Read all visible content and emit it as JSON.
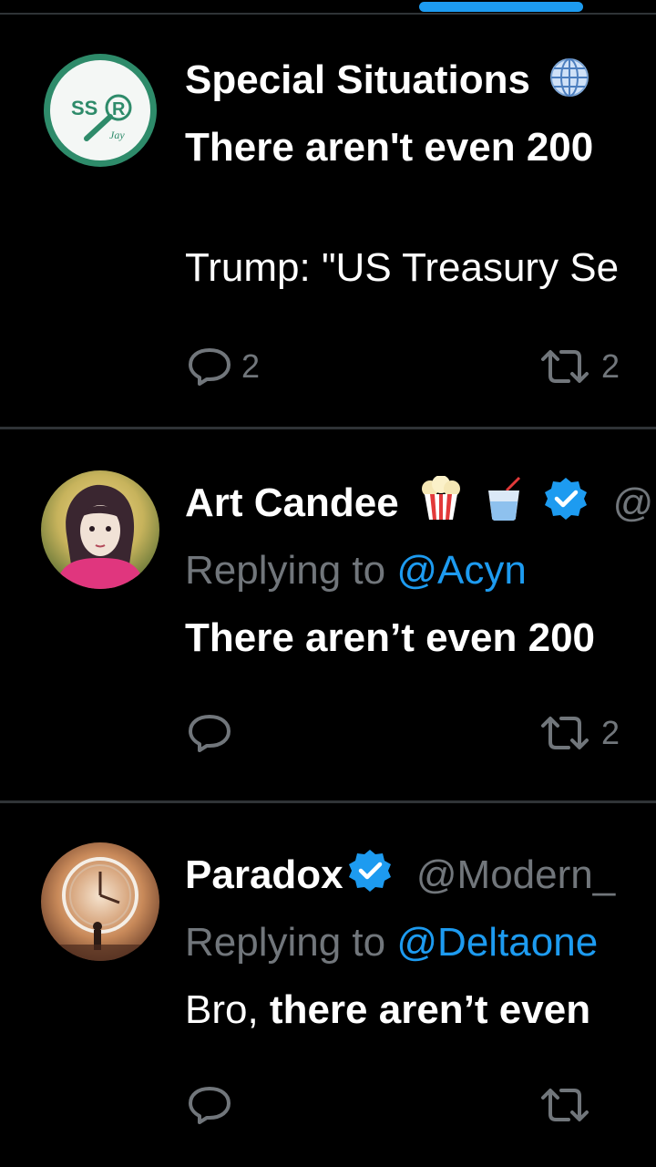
{
  "header": {
    "active_tab_color": "#1d9bf0"
  },
  "tweets": [
    {
      "author": "Special Situations",
      "avatar": {
        "initials": "SS",
        "letter": "R",
        "sub": "Jay",
        "ring": "#2e8b6a"
      },
      "line1": "There aren't even 200",
      "line2": "Trump: \"US Treasury Se",
      "reply_count": "2",
      "repost_count": "2"
    },
    {
      "author": "Art Candee",
      "handle_fragment": "@",
      "replying_label": "Replying to",
      "replying_to": "@Acyn",
      "line1": "There aren’t even 200",
      "reply_count": "",
      "repost_count": "2"
    },
    {
      "author": "Paradox",
      "handle": "@Modern_",
      "replying_label": "Replying to",
      "replying_to": "@Deltaone",
      "line1_prefix": "Bro,",
      "line1_rest": " there aren’t even",
      "reply_count": "",
      "repost_count": ""
    }
  ],
  "colors": {
    "background": "#000000",
    "divider": "#2f3336",
    "muted": "#71767b",
    "link": "#1d9bf0",
    "verified": "#1d9bf0"
  },
  "icons": [
    "globe-icon",
    "verified-badge-icon",
    "popcorn-icon",
    "drink-icon",
    "reply-icon",
    "repost-icon"
  ]
}
